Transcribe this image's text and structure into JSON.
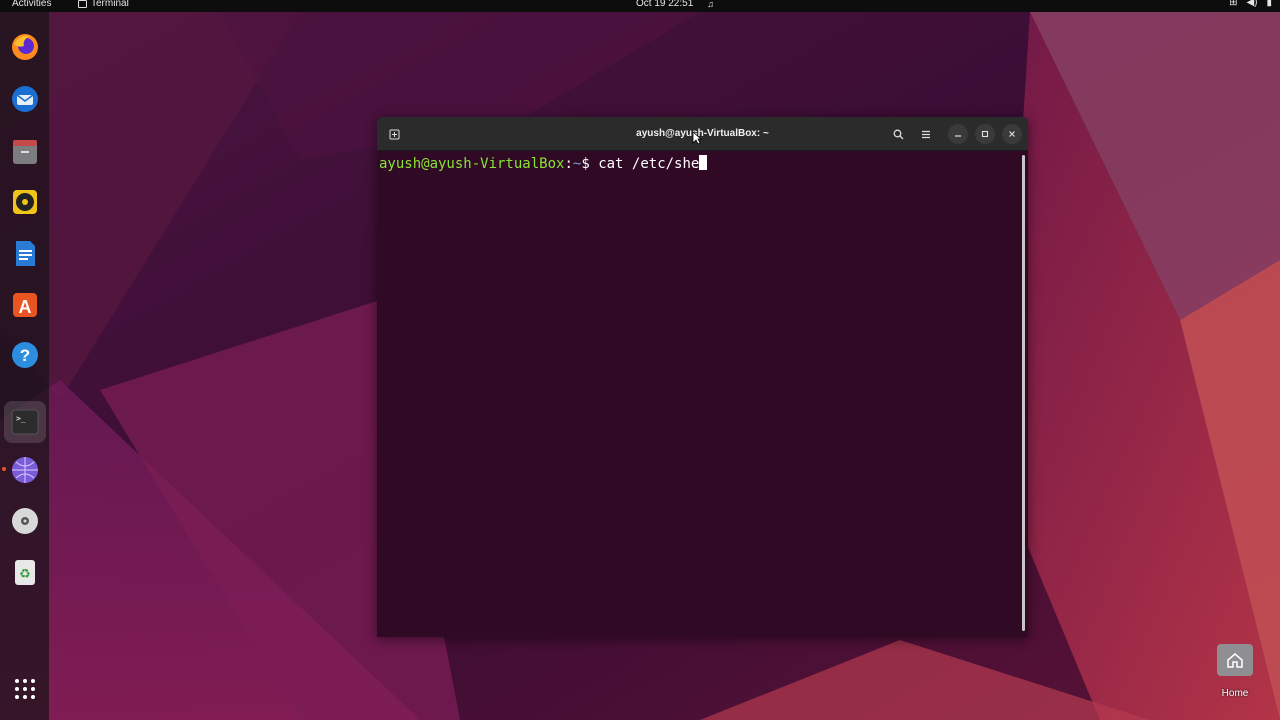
{
  "topbar": {
    "activities": "Activities",
    "app_name": "Terminal",
    "clock": "Oct 19  22:51"
  },
  "dock": {
    "items": [
      "firefox",
      "thunderbird",
      "files",
      "rhythmbox",
      "libreoffice-writer",
      "app-center",
      "help",
      "terminal",
      "browser",
      "disc",
      "trash"
    ],
    "active": "terminal"
  },
  "desktop": {
    "home_label": "Home"
  },
  "terminal": {
    "title": "ayush@ayush-VirtualBox: ~",
    "prompt_user": "ayush@ayush-VirtualBox",
    "prompt_sep": ":",
    "prompt_path": "~",
    "prompt_symbol": "$",
    "command": "cat /etc/she"
  },
  "colors": {
    "terminal_bg": "#300a24",
    "prompt_user": "#8ae234",
    "prompt_path": "#729fcf",
    "accent": "#e95420"
  }
}
